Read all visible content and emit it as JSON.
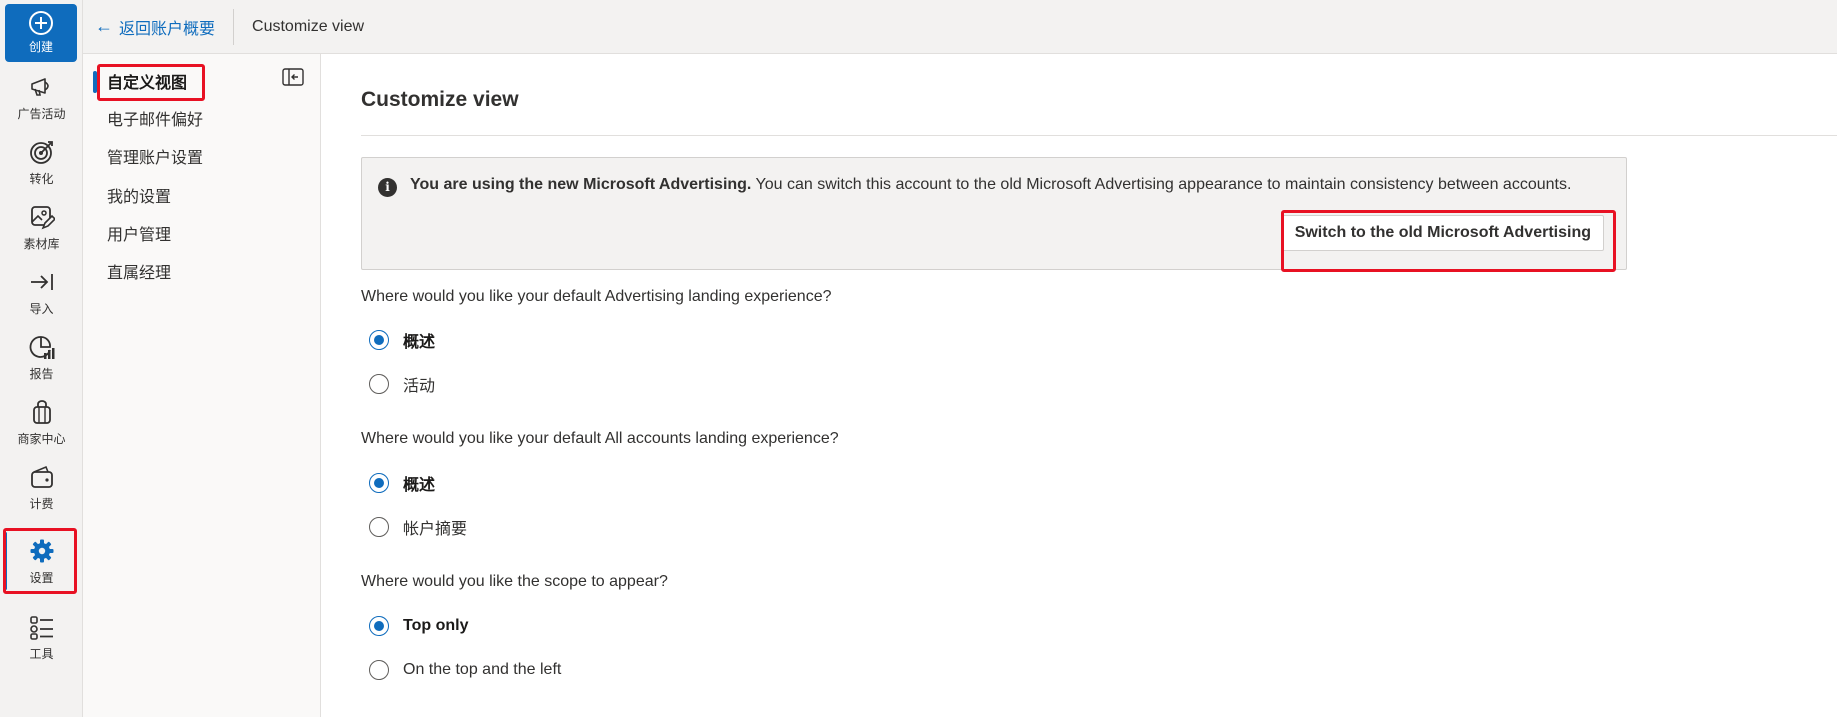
{
  "rail": {
    "create_label": "创建",
    "items": [
      {
        "label": "广告活动",
        "icon": "megaphone-icon"
      },
      {
        "label": "转化",
        "icon": "target-icon"
      },
      {
        "label": "素材库",
        "icon": "image-edit-icon"
      },
      {
        "label": "导入",
        "icon": "import-arrow-icon"
      },
      {
        "label": "报告",
        "icon": "chart-pie-icon"
      },
      {
        "label": "商家中心",
        "icon": "shopping-bag-icon"
      },
      {
        "label": "计费",
        "icon": "wallet-icon"
      },
      {
        "label": "设置",
        "icon": "gear-icon"
      },
      {
        "label": "工具",
        "icon": "tools-list-icon"
      }
    ],
    "active_label": "设置"
  },
  "header": {
    "back_label": "返回账户概要",
    "title": "Customize view"
  },
  "subnav": {
    "items": [
      {
        "label": "自定义视图",
        "selected": true
      },
      {
        "label": "电子邮件偏好",
        "selected": false
      },
      {
        "label": "管理账户设置",
        "selected": false
      },
      {
        "label": "我的设置",
        "selected": false
      },
      {
        "label": "用户管理",
        "selected": false
      },
      {
        "label": "直属经理",
        "selected": false
      }
    ]
  },
  "main": {
    "title": "Customize view",
    "message": {
      "bold": "You are using the new Microsoft Advertising.",
      "text": " You can switch this account to the old Microsoft Advertising appearance to maintain consistency between accounts."
    },
    "switch_button": "Switch to the old Microsoft Advertising",
    "questions": [
      {
        "text": "Where would you like your default Advertising landing experience?",
        "options": [
          {
            "label": "概述",
            "selected": true
          },
          {
            "label": "活动",
            "selected": false
          }
        ]
      },
      {
        "text": "Where would you like your default All accounts landing experience?",
        "options": [
          {
            "label": "概述",
            "selected": true
          },
          {
            "label": "帐户摘要",
            "selected": false
          }
        ]
      },
      {
        "text": "Where would you like the scope to appear?",
        "options": [
          {
            "label": "Top only",
            "selected": true
          },
          {
            "label": "On the top and the left",
            "selected": false
          }
        ]
      }
    ]
  },
  "colors": {
    "accent": "#0f6cbd",
    "highlight": "#e81123"
  }
}
